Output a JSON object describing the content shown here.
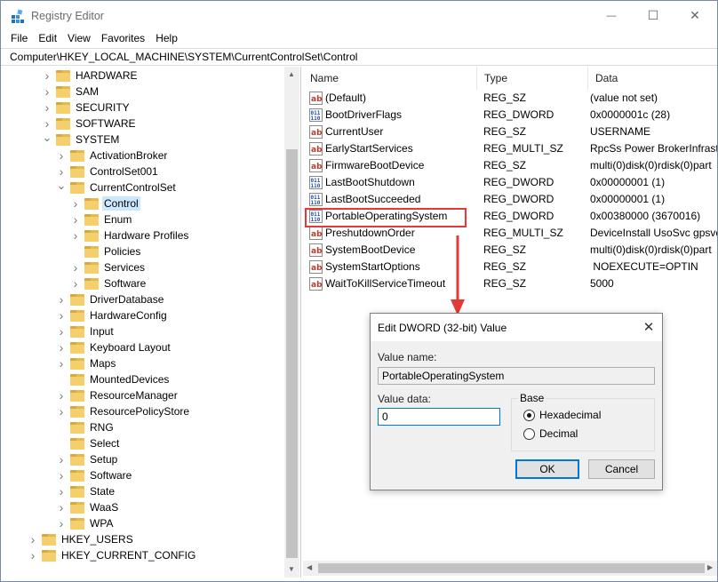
{
  "window": {
    "title": "Registry Editor",
    "controls": {
      "minimize": "—",
      "maximize": "☐",
      "close": "✕"
    }
  },
  "menu": [
    "File",
    "Edit",
    "View",
    "Favorites",
    "Help"
  ],
  "address": "Computer\\HKEY_LOCAL_MACHINE\\SYSTEM\\CurrentControlSet\\Control",
  "tree": [
    {
      "label": "HARDWARE",
      "expander": ">",
      "level": 0
    },
    {
      "label": "SAM",
      "expander": ">",
      "level": 0
    },
    {
      "label": "SECURITY",
      "expander": ">",
      "level": 0
    },
    {
      "label": "SOFTWARE",
      "expander": ">",
      "level": 0
    },
    {
      "label": "SYSTEM",
      "expander": "v",
      "level": 0
    },
    {
      "label": "ActivationBroker",
      "expander": ">",
      "level": 1
    },
    {
      "label": "ControlSet001",
      "expander": ">",
      "level": 1
    },
    {
      "label": "CurrentControlSet",
      "expander": "v",
      "level": 1
    },
    {
      "label": "Control",
      "expander": ">",
      "level": 2,
      "selected": true
    },
    {
      "label": "Enum",
      "expander": ">",
      "level": 2
    },
    {
      "label": "Hardware Profiles",
      "expander": ">",
      "level": 2
    },
    {
      "label": "Policies",
      "expander": "",
      "level": 2
    },
    {
      "label": "Services",
      "expander": ">",
      "level": 2
    },
    {
      "label": "Software",
      "expander": ">",
      "level": 2
    },
    {
      "label": "DriverDatabase",
      "expander": ">",
      "level": 1
    },
    {
      "label": "HardwareConfig",
      "expander": ">",
      "level": 1
    },
    {
      "label": "Input",
      "expander": ">",
      "level": 1
    },
    {
      "label": "Keyboard Layout",
      "expander": ">",
      "level": 1
    },
    {
      "label": "Maps",
      "expander": ">",
      "level": 1
    },
    {
      "label": "MountedDevices",
      "expander": "",
      "level": 1
    },
    {
      "label": "ResourceManager",
      "expander": ">",
      "level": 1
    },
    {
      "label": "ResourcePolicyStore",
      "expander": ">",
      "level": 1
    },
    {
      "label": "RNG",
      "expander": "",
      "level": 1
    },
    {
      "label": "Select",
      "expander": "",
      "level": 1
    },
    {
      "label": "Setup",
      "expander": ">",
      "level": 1
    },
    {
      "label": "Software",
      "expander": ">",
      "level": 1
    },
    {
      "label": "State",
      "expander": ">",
      "level": 1
    },
    {
      "label": "WaaS",
      "expander": ">",
      "level": 1
    },
    {
      "label": "WPA",
      "expander": ">",
      "level": 1
    },
    {
      "label": "HKEY_USERS",
      "expander": ">",
      "level": -1
    },
    {
      "label": "HKEY_CURRENT_CONFIG",
      "expander": ">",
      "level": -1
    }
  ],
  "columns": {
    "name": "Name",
    "type": "Type",
    "data": "Data"
  },
  "values": [
    {
      "kind": "sz",
      "name": "(Default)",
      "type": "REG_SZ",
      "data": "(value not set)"
    },
    {
      "kind": "bin",
      "name": "BootDriverFlags",
      "type": "REG_DWORD",
      "data": "0x0000001c (28)"
    },
    {
      "kind": "sz",
      "name": "CurrentUser",
      "type": "REG_SZ",
      "data": "USERNAME"
    },
    {
      "kind": "sz",
      "name": "EarlyStartServices",
      "type": "REG_MULTI_SZ",
      "data": "RpcSs Power BrokerInfrast"
    },
    {
      "kind": "sz",
      "name": "FirmwareBootDevice",
      "type": "REG_SZ",
      "data": "multi(0)disk(0)rdisk(0)part"
    },
    {
      "kind": "bin",
      "name": "LastBootShutdown",
      "type": "REG_DWORD",
      "data": "0x00000001 (1)"
    },
    {
      "kind": "bin",
      "name": "LastBootSucceeded",
      "type": "REG_DWORD",
      "data": "0x00000001 (1)"
    },
    {
      "kind": "bin",
      "name": "PortableOperatingSystem",
      "type": "REG_DWORD",
      "data": "0x00380000 (3670016)"
    },
    {
      "kind": "sz",
      "name": "PreshutdownOrder",
      "type": "REG_MULTI_SZ",
      "data": "DeviceInstall UsoSvc gpsvc"
    },
    {
      "kind": "sz",
      "name": "SystemBootDevice",
      "type": "REG_SZ",
      "data": "multi(0)disk(0)rdisk(0)part"
    },
    {
      "kind": "sz",
      "name": "SystemStartOptions",
      "type": "REG_SZ",
      "data": " NOEXECUTE=OPTIN"
    },
    {
      "kind": "sz",
      "name": "WaitToKillServiceTimeout",
      "type": "REG_SZ",
      "data": "5000"
    }
  ],
  "dialog": {
    "title": "Edit DWORD (32-bit) Value",
    "close": "✕",
    "value_name_label": "Value name:",
    "value_name": "PortableOperatingSystem",
    "value_data_label": "Value data:",
    "value_data": "0",
    "base_label": "Base",
    "base_options": [
      {
        "label": "Hexadecimal",
        "selected": true
      },
      {
        "label": "Decimal",
        "selected": false
      }
    ],
    "ok": "OK",
    "cancel": "Cancel"
  },
  "colors": {
    "highlight": "#e53935",
    "selection": "#cce8ff",
    "folder": "#f5cf6b",
    "accent": "#0078d7"
  }
}
